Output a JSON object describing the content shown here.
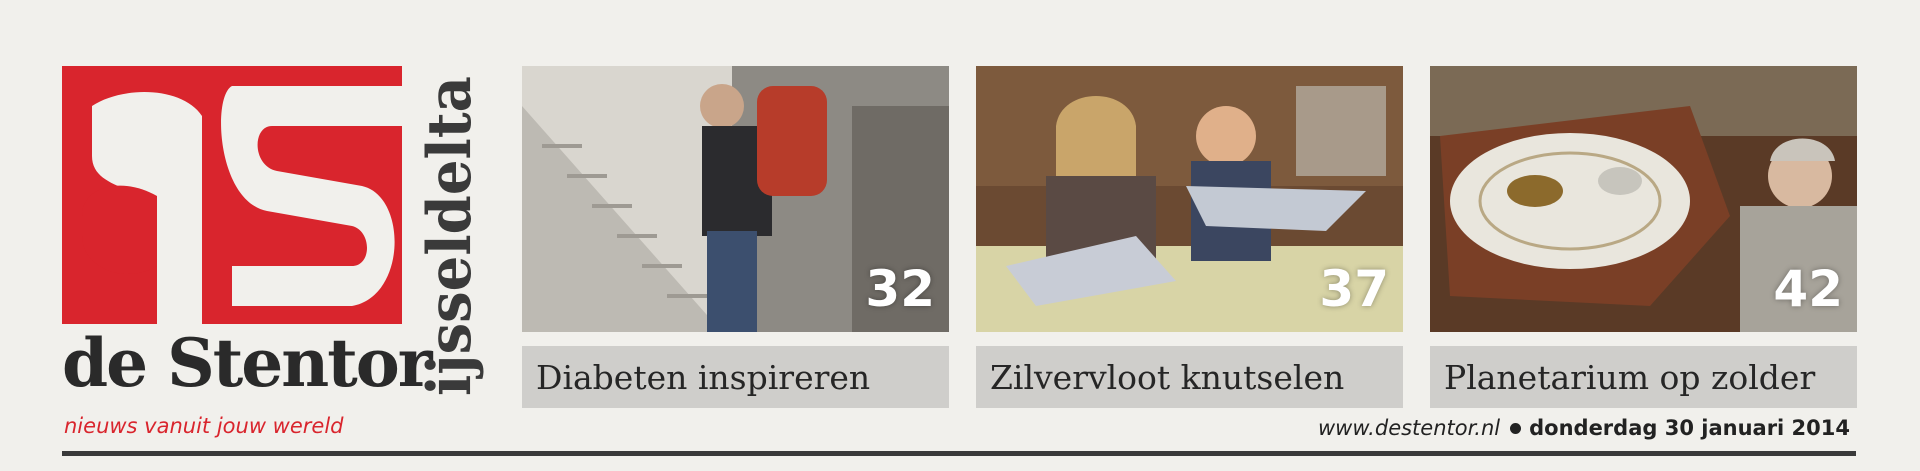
{
  "brand": {
    "logo_letters": "aS",
    "name": "de Stentor",
    "region": "ijsseldelta",
    "tagline": "nieuws vanuit jouw wereld",
    "accent_color": "#d9252d"
  },
  "teasers": [
    {
      "page": "32",
      "caption": "Diabeten inspireren",
      "photo": "woman-climbing-stairs-with-backpack"
    },
    {
      "page": "37",
      "caption": "Zilvervloot knutselen",
      "photo": "children-crafting-silver-paper-fish"
    },
    {
      "page": "42",
      "caption": "Planetarium op zolder",
      "photo": "man-beside-planetarium-model"
    }
  ],
  "footer": {
    "url": "www.destentor.nl",
    "date": "donderdag 30 januari 2014"
  }
}
